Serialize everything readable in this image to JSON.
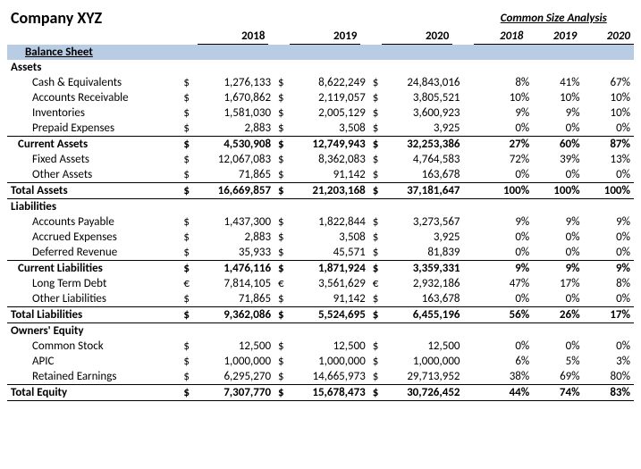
{
  "company": "Company XYZ",
  "csa_title": "Common Size Analysis",
  "years": [
    "2018",
    "2019",
    "2020"
  ],
  "section_band": "Balance Sheet",
  "groups": {
    "assets": "Assets",
    "liabilities": "Liabilities",
    "equity": "Owners' Equity"
  },
  "rows": {
    "cash": {
      "label": "Cash & Equivalents",
      "c": "$",
      "v": [
        "1,276,133",
        "8,622,249",
        "24,843,016"
      ],
      "p": [
        "8%",
        "41%",
        "67%"
      ]
    },
    "ar": {
      "label": "Accounts Receivable",
      "c": "$",
      "v": [
        "1,670,862",
        "2,119,057",
        "3,805,521"
      ],
      "p": [
        "10%",
        "10%",
        "10%"
      ]
    },
    "inv": {
      "label": "Inventories",
      "c": "$",
      "v": [
        "1,581,030",
        "2,005,129",
        "3,600,923"
      ],
      "p": [
        "9%",
        "9%",
        "10%"
      ]
    },
    "prepaid": {
      "label": "Prepaid Expenses",
      "c": "$",
      "v": [
        "2,883",
        "3,508",
        "3,925"
      ],
      "p": [
        "0%",
        "0%",
        "0%"
      ]
    },
    "ca": {
      "label": "Current Assets",
      "c": "$",
      "v": [
        "4,530,908",
        "12,749,943",
        "32,253,386"
      ],
      "p": [
        "27%",
        "60%",
        "87%"
      ]
    },
    "fixed": {
      "label": "Fixed Assets",
      "c": "$",
      "v": [
        "12,067,083",
        "8,362,083",
        "4,764,583"
      ],
      "p": [
        "72%",
        "39%",
        "13%"
      ]
    },
    "other_a": {
      "label": "Other Assets",
      "c": "$",
      "v": [
        "71,865",
        "91,142",
        "163,678"
      ],
      "p": [
        "0%",
        "0%",
        "0%"
      ]
    },
    "ta": {
      "label": "Total Assets",
      "c": "$",
      "v": [
        "16,669,857",
        "21,203,168",
        "37,181,647"
      ],
      "p": [
        "100%",
        "100%",
        "100%"
      ]
    },
    "ap": {
      "label": "Accounts Payable",
      "c": "$",
      "v": [
        "1,437,300",
        "1,822,844",
        "3,273,567"
      ],
      "p": [
        "9%",
        "9%",
        "9%"
      ]
    },
    "accr": {
      "label": "Accrued Expenses",
      "c": "$",
      "v": [
        "2,883",
        "3,508",
        "3,925"
      ],
      "p": [
        "0%",
        "0%",
        "0%"
      ]
    },
    "defrev": {
      "label": "Deferred Revenue",
      "c": "$",
      "v": [
        "35,933",
        "45,571",
        "81,839"
      ],
      "p": [
        "0%",
        "0%",
        "0%"
      ]
    },
    "cl": {
      "label": "Current Liabilities",
      "c": "$",
      "v": [
        "1,476,116",
        "1,871,924",
        "3,359,331"
      ],
      "p": [
        "9%",
        "9%",
        "9%"
      ]
    },
    "ltd": {
      "label": "Long Term Debt",
      "c": "€",
      "v": [
        "7,814,105",
        "3,561,629",
        "2,932,186"
      ],
      "p": [
        "47%",
        "17%",
        "8%"
      ]
    },
    "other_l": {
      "label": "Other Liabilities",
      "c": "$",
      "v": [
        "71,865",
        "91,142",
        "163,678"
      ],
      "p": [
        "0%",
        "0%",
        "0%"
      ]
    },
    "tl": {
      "label": "Total Liabilities",
      "c": "$",
      "v": [
        "9,362,086",
        "5,524,695",
        "6,455,196"
      ],
      "p": [
        "56%",
        "26%",
        "17%"
      ]
    },
    "cs": {
      "label": "Common Stock",
      "c": "$",
      "v": [
        "12,500",
        "12,500",
        "12,500"
      ],
      "p": [
        "0%",
        "0%",
        "0%"
      ]
    },
    "apic": {
      "label": "APIC",
      "c": "$",
      "v": [
        "1,000,000",
        "1,000,000",
        "1,000,000"
      ],
      "p": [
        "6%",
        "5%",
        "3%"
      ]
    },
    "re": {
      "label": "Retained Earnings",
      "c": "$",
      "v": [
        "6,295,270",
        "14,665,973",
        "29,713,952"
      ],
      "p": [
        "38%",
        "69%",
        "80%"
      ]
    },
    "te": {
      "label": "Total Equity",
      "c": "$",
      "v": [
        "7,307,770",
        "15,678,473",
        "30,726,452"
      ],
      "p": [
        "44%",
        "74%",
        "83%"
      ]
    }
  }
}
